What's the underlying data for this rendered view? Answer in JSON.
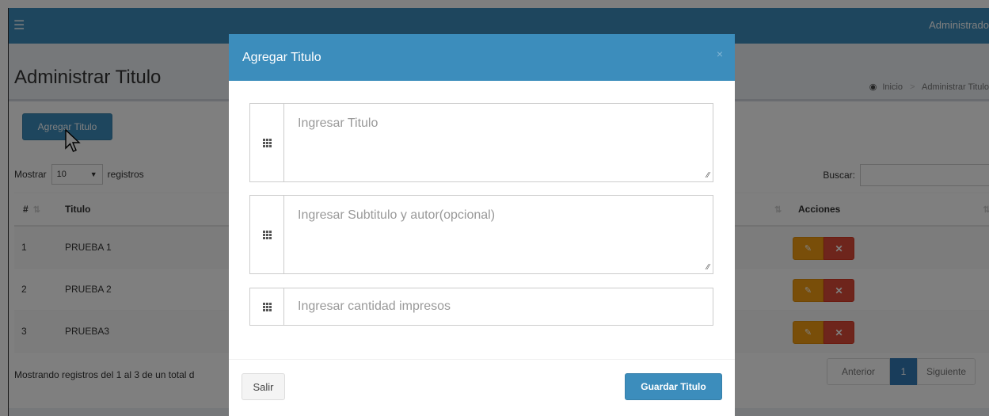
{
  "topbar": {
    "menu_icon": "hamburger-icon",
    "user_label": "Administrado"
  },
  "page": {
    "title": "Administrar Titulo",
    "breadcrumb": {
      "home_icon": "dashboard-icon",
      "home": "Inicio",
      "current": "Administrar Titulo"
    }
  },
  "toolbar": {
    "add_label": "Agregar Titulo"
  },
  "table_controls": {
    "show_label": "Mostrar",
    "page_size": "10",
    "records_label": "registros",
    "search_label": "Buscar:"
  },
  "table": {
    "headers": {
      "num": "#",
      "title": "Titulo",
      "actions": "Acciones"
    },
    "rows": [
      {
        "num": "1",
        "title": "PRUEBA 1"
      },
      {
        "num": "2",
        "title": "PRUEBA 2"
      },
      {
        "num": "3",
        "title": "PRUEBA3"
      }
    ],
    "row_action_icons": {
      "edit": "pencil-icon",
      "delete": "times-icon"
    }
  },
  "footer": {
    "info": "Mostrando registros del 1 al 3 de un total d",
    "prev": "Anterior",
    "current_page": "1",
    "next": "Siguiente"
  },
  "modal": {
    "title": "Agregar Titulo",
    "close": "×",
    "fields": {
      "titulo_placeholder": "Ingresar Titulo",
      "subtitulo_placeholder": "Ingresar Subtitulo y autor(opcional)",
      "cantidad_placeholder": "Ingresar cantidad impresos"
    },
    "salir_label": "Salir",
    "guardar_label": "Guardar Titulo"
  },
  "colors": {
    "primary": "#3c8dbc",
    "warning": "#f39c12",
    "danger": "#dd4b39"
  }
}
